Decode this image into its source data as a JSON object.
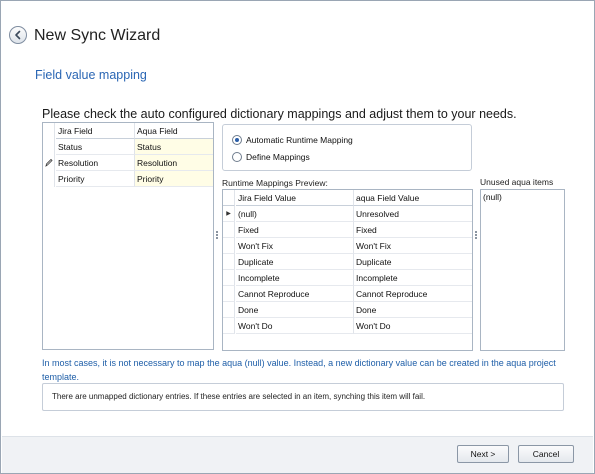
{
  "window": {
    "title": "New Sync Wizard"
  },
  "header": {
    "back_icon": "arrow-left-icon"
  },
  "page_title": "Field value mapping",
  "instructions": "Please check the auto configured dictionary mappings and adjust them to your needs.",
  "dictionary_grid": {
    "columns": [
      "Jira Field",
      "Aqua Field"
    ],
    "rows": [
      {
        "jira": "Status",
        "aqua": "Status",
        "edit_icon": false
      },
      {
        "jira": "Resolution",
        "aqua": "Resolution",
        "edit_icon": true
      },
      {
        "jira": "Priority",
        "aqua": "Priority",
        "edit_icon": false
      }
    ]
  },
  "mapping_options": {
    "automatic_label": "Automatic Runtime Mapping",
    "define_label": "Define Mappings",
    "selected": "automatic"
  },
  "runtime_preview": {
    "label": "Runtime Mappings Preview:",
    "columns": [
      "Jira Field Value",
      "aqua Field Value"
    ],
    "rows": [
      {
        "jira": "(null)",
        "aqua": "Unresolved",
        "current": true
      },
      {
        "jira": "Fixed",
        "aqua": "Fixed"
      },
      {
        "jira": "Won't Fix",
        "aqua": "Won't Fix"
      },
      {
        "jira": "Duplicate",
        "aqua": "Duplicate"
      },
      {
        "jira": "Incomplete",
        "aqua": "Incomplete"
      },
      {
        "jira": "Cannot Reproduce",
        "aqua": "Cannot Reproduce"
      },
      {
        "jira": "Done",
        "aqua": "Done"
      },
      {
        "jira": "Won't Do",
        "aqua": "Won't Do"
      }
    ]
  },
  "unused": {
    "label": "Unused aqua items",
    "items": [
      "(null)"
    ]
  },
  "note": "In most cases, it is not necessary to map the aqua (null) value. Instead, a new dictionary value can be created in the aqua project template.",
  "warning": "There are unmapped dictionary entries. If these entries are selected in an item, synching this item will fail.",
  "footer": {
    "next_label": "Next >",
    "cancel_label": "Cancel"
  },
  "colors": {
    "accent": "#2a66b4",
    "note_text": "#1e5ea8",
    "cell_highlight": "#fffde6"
  }
}
